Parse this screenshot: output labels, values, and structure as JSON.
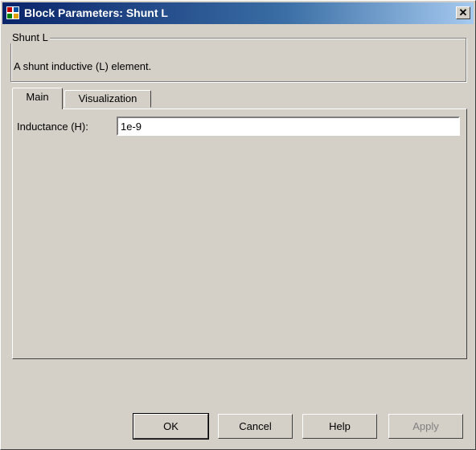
{
  "window": {
    "title": "Block Parameters: Shunt L"
  },
  "group": {
    "title": "Shunt L",
    "description": "A shunt inductive (L) element."
  },
  "tabs": [
    {
      "label": "Main",
      "selected": true
    },
    {
      "label": "Visualization",
      "selected": false
    }
  ],
  "main": {
    "inductance_label": "Inductance (H):",
    "inductance_value": "1e-9"
  },
  "buttons": {
    "ok": "OK",
    "cancel": "Cancel",
    "help": "Help",
    "apply": "Apply"
  },
  "close_glyph": "✕"
}
